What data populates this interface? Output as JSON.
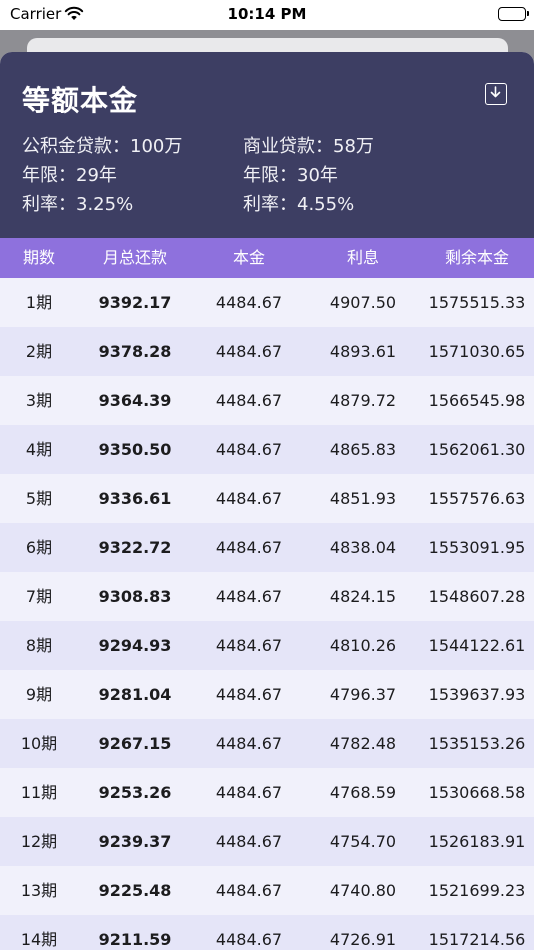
{
  "status_bar": {
    "carrier": "Carrier",
    "time": "10:14 PM"
  },
  "header": {
    "title": "等额本金",
    "download_icon": "download-icon",
    "fund_loan": "公积金贷款：100万",
    "commercial_loan": "商业贷款：58万",
    "fund_years": "年限：29年",
    "commercial_years": "年限：30年",
    "fund_rate": "利率：3.25%",
    "commercial_rate": "利率：4.55%"
  },
  "table": {
    "columns": [
      "期数",
      "月总还款",
      "本金",
      "利息",
      "剩余本金"
    ],
    "rows": [
      [
        "1期",
        "9392.17",
        "4484.67",
        "4907.50",
        "1575515.33"
      ],
      [
        "2期",
        "9378.28",
        "4484.67",
        "4893.61",
        "1571030.65"
      ],
      [
        "3期",
        "9364.39",
        "4484.67",
        "4879.72",
        "1566545.98"
      ],
      [
        "4期",
        "9350.50",
        "4484.67",
        "4865.83",
        "1562061.30"
      ],
      [
        "5期",
        "9336.61",
        "4484.67",
        "4851.93",
        "1557576.63"
      ],
      [
        "6期",
        "9322.72",
        "4484.67",
        "4838.04",
        "1553091.95"
      ],
      [
        "7期",
        "9308.83",
        "4484.67",
        "4824.15",
        "1548607.28"
      ],
      [
        "8期",
        "9294.93",
        "4484.67",
        "4810.26",
        "1544122.61"
      ],
      [
        "9期",
        "9281.04",
        "4484.67",
        "4796.37",
        "1539637.93"
      ],
      [
        "10期",
        "9267.15",
        "4484.67",
        "4782.48",
        "1535153.26"
      ],
      [
        "11期",
        "9253.26",
        "4484.67",
        "4768.59",
        "1530668.58"
      ],
      [
        "12期",
        "9239.37",
        "4484.67",
        "4754.70",
        "1526183.91"
      ],
      [
        "13期",
        "9225.48",
        "4484.67",
        "4740.80",
        "1521699.23"
      ],
      [
        "14期",
        "9211.59",
        "4484.67",
        "4726.91",
        "1517214.56"
      ]
    ]
  },
  "colors": {
    "header_bg": "#3d3e63",
    "table_header_bg": "#8e71dd",
    "row_odd": "#f1f1fb",
    "row_even": "#e5e5f8"
  }
}
